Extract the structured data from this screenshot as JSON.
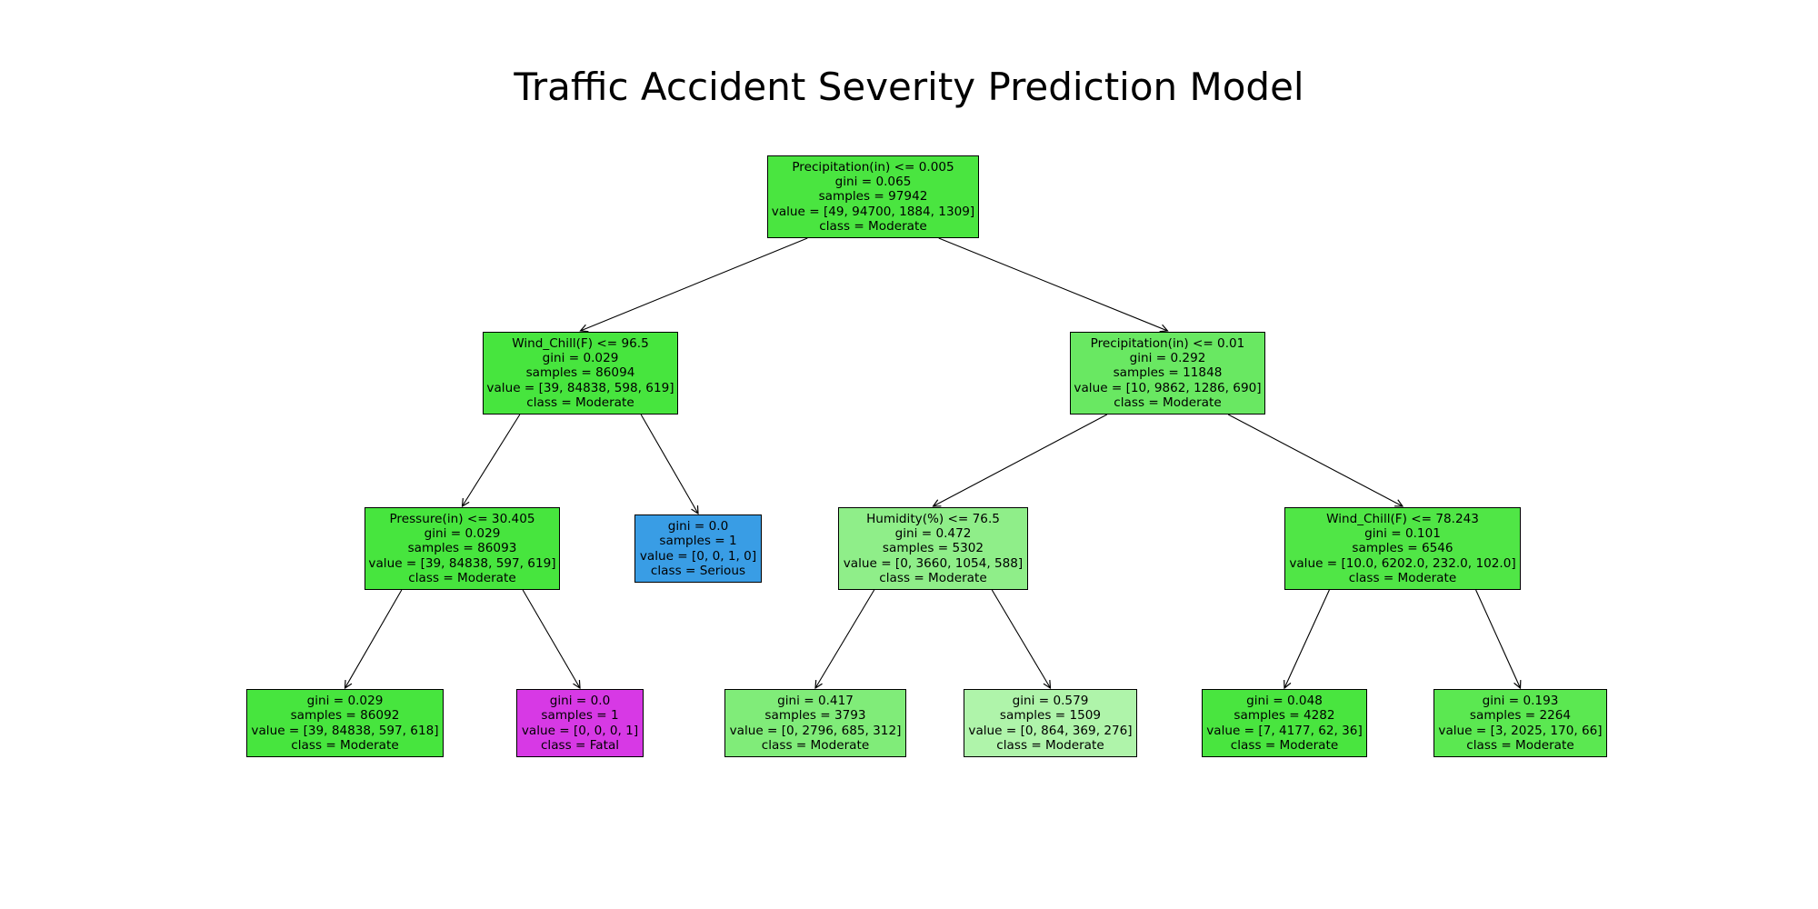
{
  "title": "Traffic Accident Severity Prediction Model",
  "class_colors": {
    "Serious": "#399de5",
    "Fatal": "#d739e5"
  },
  "tree": {
    "nodes": [
      {
        "id": 0,
        "depth": 0,
        "lines": [
          "Precipitation(in) <= 0.005",
          "gini = 0.065",
          "samples = 97942",
          "value = [49, 94700, 1884, 1309]",
          "class = Moderate"
        ],
        "fill": "#4ae540",
        "children": [
          1,
          2
        ]
      },
      {
        "id": 1,
        "depth": 1,
        "lines": [
          "Wind_Chill(F) <= 96.5",
          "gini = 0.029",
          "samples = 86094",
          "value = [39, 84838, 598, 619]",
          "class = Moderate"
        ],
        "fill": "#47e53e",
        "children": [
          3,
          4
        ]
      },
      {
        "id": 2,
        "depth": 1,
        "lines": [
          "Precipitation(in) <= 0.01",
          "gini = 0.292",
          "samples = 11848",
          "value = [10, 9862, 1286, 690]",
          "class = Moderate"
        ],
        "fill": "#69e862",
        "children": [
          5,
          6
        ]
      },
      {
        "id": 3,
        "depth": 2,
        "lines": [
          "Pressure(in) <= 30.405",
          "gini = 0.029",
          "samples = 86093",
          "value = [39, 84838, 597, 619]",
          "class = Moderate"
        ],
        "fill": "#47e53e",
        "children": [
          7,
          8
        ]
      },
      {
        "id": 4,
        "depth": 2,
        "lines": [
          "gini = 0.0",
          "samples = 1",
          "value = [0, 0, 1, 0]",
          "class = Serious"
        ],
        "fill": "#399de5",
        "children": []
      },
      {
        "id": 5,
        "depth": 2,
        "lines": [
          "Humidity(%) <= 76.5",
          "gini = 0.472",
          "samples = 5302",
          "value = [0, 3660, 1054, 588]",
          "class = Moderate"
        ],
        "fill": "#8fee89",
        "children": [
          9,
          10
        ]
      },
      {
        "id": 6,
        "depth": 2,
        "lines": [
          "Wind_Chill(F) <= 78.243",
          "gini = 0.101",
          "samples = 6546",
          "value = [10.0, 6202.0, 232.0, 102.0]",
          "class = Moderate"
        ],
        "fill": "#50e646",
        "children": [
          11,
          12
        ]
      },
      {
        "id": 7,
        "depth": 3,
        "lines": [
          "gini = 0.029",
          "samples = 86092",
          "value = [39, 84838, 597, 618]",
          "class = Moderate"
        ],
        "fill": "#47e53e",
        "children": []
      },
      {
        "id": 8,
        "depth": 3,
        "lines": [
          "gini = 0.0",
          "samples = 1",
          "value = [0, 0, 0, 1]",
          "class = Fatal"
        ],
        "fill": "#d739e5",
        "children": []
      },
      {
        "id": 9,
        "depth": 3,
        "lines": [
          "gini = 0.417",
          "samples = 3793",
          "value = [0, 2796, 685, 312]",
          "class = Moderate"
        ],
        "fill": "#80ec79",
        "children": []
      },
      {
        "id": 10,
        "depth": 3,
        "lines": [
          "gini = 0.579",
          "samples = 1509",
          "value = [0, 864, 369, 276]",
          "class = Moderate"
        ],
        "fill": "#aff4aa",
        "children": []
      },
      {
        "id": 11,
        "depth": 3,
        "lines": [
          "gini = 0.048",
          "samples = 4282",
          "value = [7, 4177, 62, 36]",
          "class = Moderate"
        ],
        "fill": "#49e53f",
        "children": []
      },
      {
        "id": 12,
        "depth": 3,
        "lines": [
          "gini = 0.193",
          "samples = 2264",
          "value = [3, 2025, 170, 66]",
          "class = Moderate"
        ],
        "fill": "#5be851",
        "children": []
      }
    ]
  }
}
